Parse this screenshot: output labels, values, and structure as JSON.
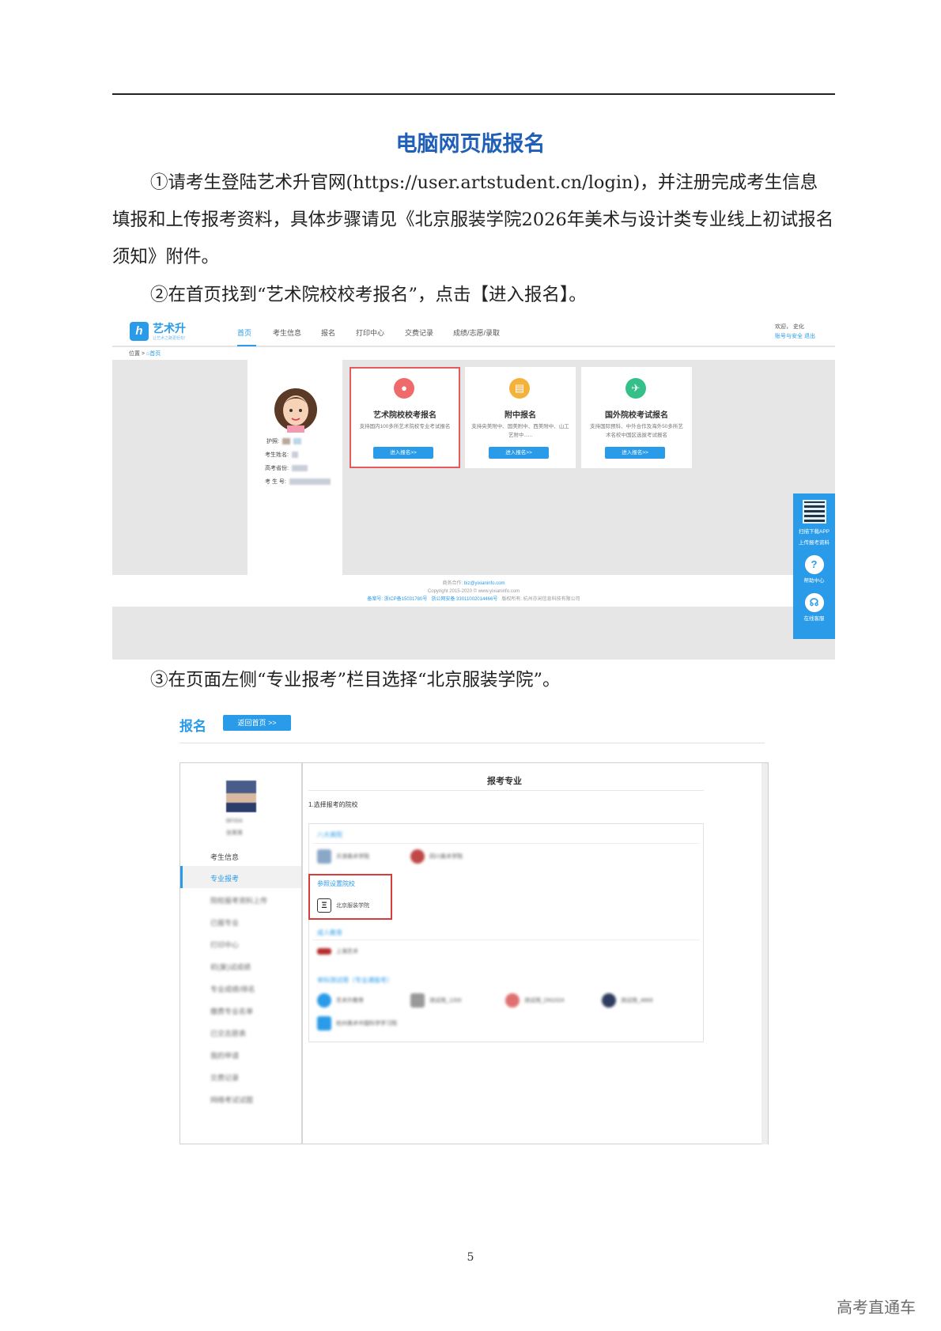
{
  "doc": {
    "title": "电脑网页版报名",
    "step1": "①请考生登陆艺术升官网(https://user.artstudent.cn/login)，并注册完成考生信息填报和上传报考资料，具体步骤请见《北京服装学院2026年美术与设计类专业线上初试报名须知》附件。",
    "step2": "②在首页找到“艺术院校校考报名”，点击【进入报名】。",
    "step3": "③在页面左侧“专业报考”栏目选择“北京服装学院”。",
    "page_number": "5",
    "watermark": "高考直通车"
  },
  "shot1": {
    "logo_mark": "h",
    "logo_text": "艺术升",
    "logo_sub": "让艺术之路更轻松!",
    "nav": [
      "首页",
      "考生信息",
      "报名",
      "打印中心",
      "交费记录",
      "成绩/志愿/录取"
    ],
    "welcome": "欢迎，  史化",
    "account_links": "账号与安全   退出",
    "breadcrumb_prefix": "位置 > ",
    "breadcrumb_home": "⌂首页",
    "profile": {
      "id_label": "护照:",
      "name_label": "考生姓名:",
      "province_label": "高考省份:",
      "number_label": "考 生 号:"
    },
    "cards": [
      {
        "title": "艺术院校校考报名",
        "desc": "支持国内100多所艺术院校专业考试报名",
        "button": "进入报名>>",
        "color": "#ef6b6b",
        "icon": "user-icon"
      },
      {
        "title": "附中报名",
        "desc": "支持央美附中、国美附中、西美附中、山工艺附中......",
        "button": "进入报名>>",
        "color": "#f4b23b",
        "icon": "book-icon"
      },
      {
        "title": "国外院校考试报名",
        "desc": "支持国际预科、中外合作及海外50多所艺术名校中国区选拔考试报名",
        "button": "进入报名>>",
        "color": "#35c08a",
        "icon": "plane-icon"
      }
    ],
    "footer": {
      "line1_label": "商务合作: ",
      "line1_email": "biz@yixianinfo.com",
      "line2": "Copyright 2015-2020 © www.yixianinfo.com",
      "line3_a": "备案号: 浙ICP备15031780号",
      "line3_b": "浙公网安备 33011002014466号",
      "line3_c": "版权所有: 杭州亦闲信息科技有限公司"
    },
    "sidebar": {
      "qr_line1": "扫描下载APP",
      "qr_line2": "上传报考资料",
      "help_glyph": "?",
      "help": "帮助中心",
      "service_glyph": "☊",
      "service": "在线客服"
    }
  },
  "shot2": {
    "title_fragment": "报名",
    "back_button": "返回首页 >>",
    "menu": [
      "考生信息",
      "专业报考",
      "院校报考资料上传",
      "已报专业",
      "打印中心",
      "初(复)试成绩",
      "专业成绩/排名",
      "缴费专业名单",
      "已交志愿表",
      "我的申请",
      "交费记录",
      "网络考试试题"
    ],
    "main_title": "报考专业",
    "subtitle": "1.选择报考的院校",
    "groups": [
      {
        "label": "八大美院",
        "schools": [
          "天津美术学院",
          "四川美术学院"
        ]
      },
      {
        "label": "参照设置院校",
        "schools": [
          "北京服装学院"
        ]
      },
      {
        "label": "成人教育",
        "schools": [
          "上海艺术"
        ]
      },
      {
        "label": "单科测试用（专业通报考）",
        "schools": [
          "艺术升教育",
          "测试用_1200",
          "测试用_DN1024",
          "测试用_4669",
          "杭州美术中国科学学习院"
        ]
      }
    ],
    "blurred_user": [
      "BF004",
      "张某某"
    ]
  }
}
